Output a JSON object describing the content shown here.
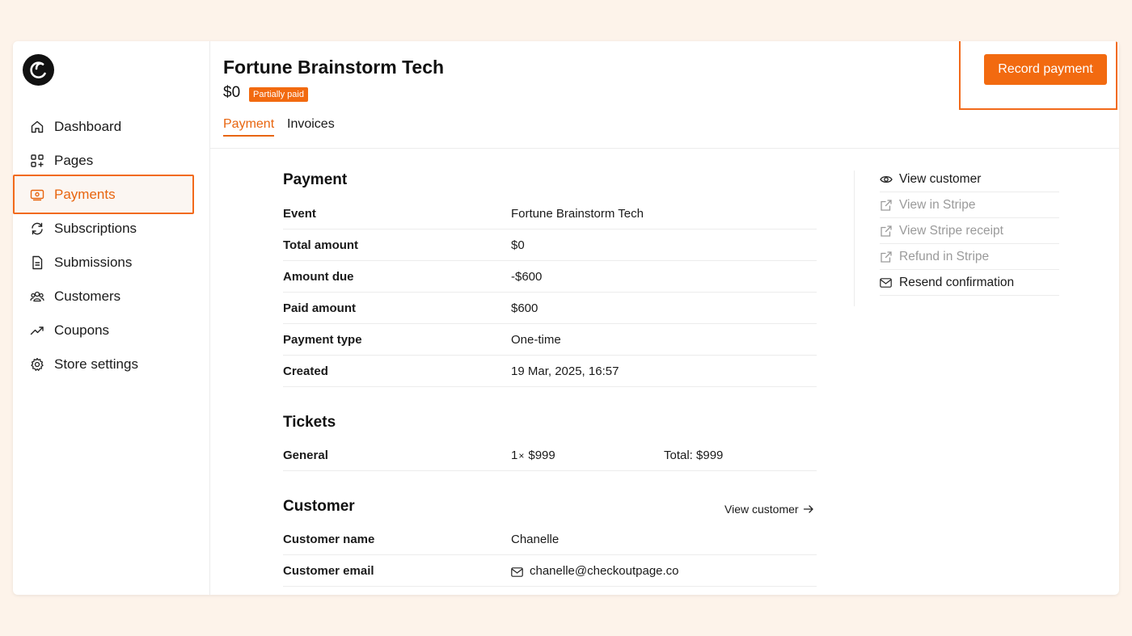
{
  "sidebar": {
    "items": [
      {
        "label": "Dashboard",
        "icon": "home-icon"
      },
      {
        "label": "Pages",
        "icon": "pages-icon"
      },
      {
        "label": "Payments",
        "icon": "payments-icon",
        "active": true
      },
      {
        "label": "Subscriptions",
        "icon": "refresh-icon"
      },
      {
        "label": "Submissions",
        "icon": "document-icon"
      },
      {
        "label": "Customers",
        "icon": "users-icon"
      },
      {
        "label": "Coupons",
        "icon": "trending-icon"
      },
      {
        "label": "Store settings",
        "icon": "gear-icon"
      }
    ]
  },
  "header": {
    "title": "Fortune Brainstorm Tech",
    "price": "$0",
    "badge": "Partially paid",
    "record_button": "Record payment",
    "tabs": [
      {
        "label": "Payment",
        "active": true
      },
      {
        "label": "Invoices",
        "active": false
      }
    ]
  },
  "payment": {
    "title": "Payment",
    "rows": [
      {
        "key": "Event",
        "value": "Fortune Brainstorm Tech"
      },
      {
        "key": "Total amount",
        "value": "$0"
      },
      {
        "key": "Amount due",
        "value": "-$600"
      },
      {
        "key": "Paid amount",
        "value": "$600"
      },
      {
        "key": "Payment type",
        "value": "One-time"
      },
      {
        "key": "Created",
        "value": "19 Mar, 2025, 16:57"
      }
    ]
  },
  "tickets": {
    "title": "Tickets",
    "rows": [
      {
        "key": "General",
        "qty": "1",
        "times": "×",
        "price": "$999",
        "total": "Total: $999"
      }
    ]
  },
  "customer": {
    "title": "Customer",
    "view_link": "View customer",
    "rows": [
      {
        "key": "Customer name",
        "value": "Chanelle"
      },
      {
        "key": "Customer email",
        "value": "chanelle@checkoutpage.co"
      }
    ]
  },
  "actions": [
    {
      "label": "View customer",
      "icon": "eye-icon",
      "enabled": true
    },
    {
      "label": "View in Stripe",
      "icon": "external-link-icon",
      "enabled": false
    },
    {
      "label": "View Stripe receipt",
      "icon": "external-link-icon",
      "enabled": false
    },
    {
      "label": "Refund in Stripe",
      "icon": "external-link-icon",
      "enabled": false
    },
    {
      "label": "Resend confirmation",
      "icon": "mail-icon",
      "enabled": true
    }
  ],
  "colors": {
    "accent": "#f26a10",
    "background": "#fdf3ea",
    "disabled_text": "#9a9a9a"
  }
}
